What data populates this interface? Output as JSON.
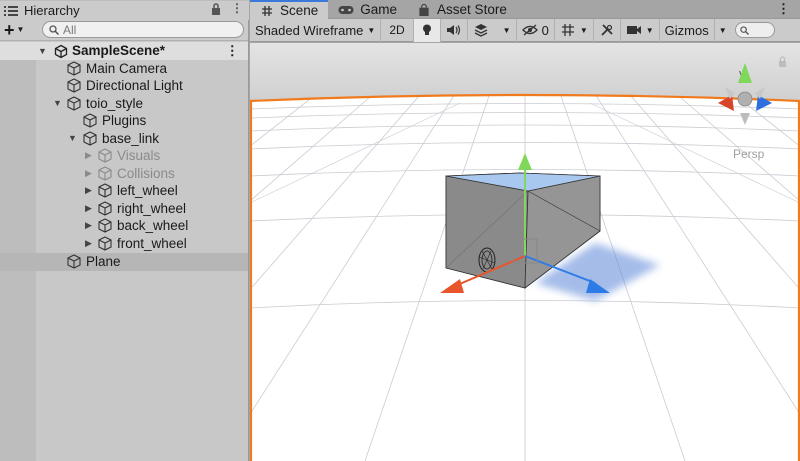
{
  "hierarchy": {
    "tab_title": "Hierarchy",
    "search_placeholder": "All",
    "scene_name": "SampleScene*",
    "items": [
      {
        "label": "Main Camera"
      },
      {
        "label": "Directional Light"
      },
      {
        "label": "toio_style"
      },
      {
        "label": "Plugins"
      },
      {
        "label": "base_link"
      },
      {
        "label": "Visuals"
      },
      {
        "label": "Collisions"
      },
      {
        "label": "left_wheel"
      },
      {
        "label": "right_wheel"
      },
      {
        "label": "back_wheel"
      },
      {
        "label": "front_wheel"
      },
      {
        "label": "Plane"
      }
    ]
  },
  "scene_tabs": [
    {
      "label": "Scene"
    },
    {
      "label": "Game"
    },
    {
      "label": "Asset Store"
    }
  ],
  "toolbar": {
    "shading_mode": "Shaded Wireframe",
    "toggle_2d": "2D",
    "hidden_count": "0",
    "gizmos_label": "Gizmos"
  },
  "viewport": {
    "projection_label": "Persp",
    "gizmo_axis_label": "y",
    "colors": {
      "x_axis": "#e8552a",
      "y_axis": "#7fd85a",
      "z_axis": "#2e7be8",
      "selection_outline": "#f07a1e"
    }
  }
}
